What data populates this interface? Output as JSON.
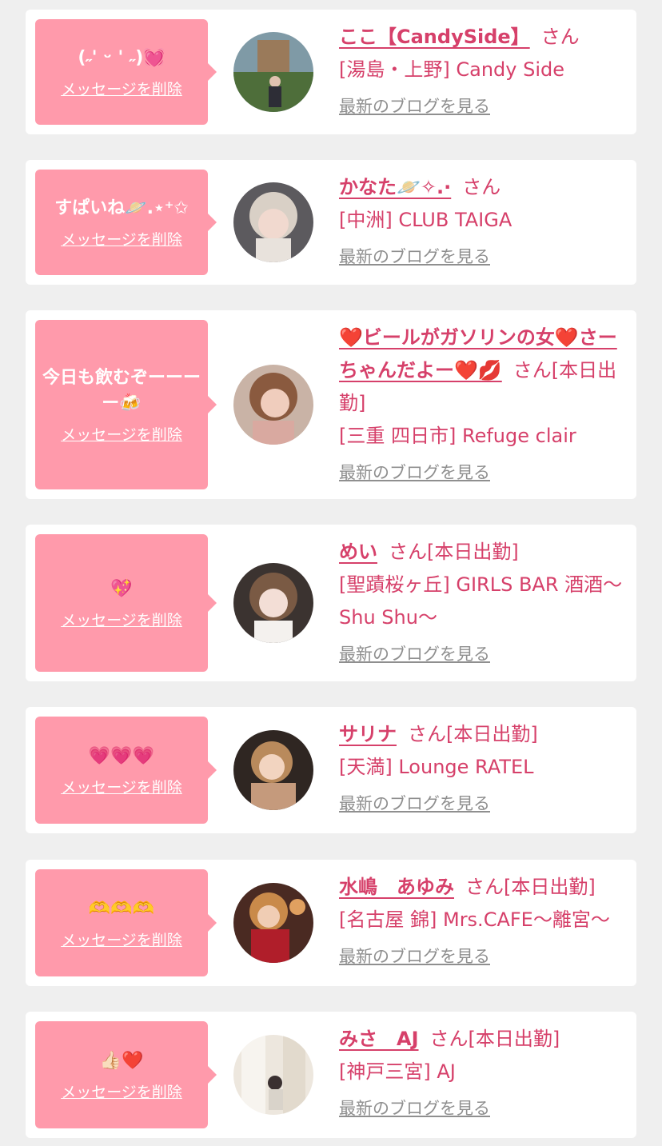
{
  "delete_label": "メッセージを削除",
  "blog_label": "最新のブログを見る",
  "suffix_san": "さん",
  "colors": {
    "bubble": "#ff9aab",
    "name": "#d6406a",
    "link_gray": "#8f8f8f",
    "background": "#efefef",
    "card": "#ffffff"
  },
  "messages": [
    {
      "message": "(˶' ᵕ ' ˶)💓",
      "name": "ここ【CandySide】",
      "status": "",
      "shop": "[湯島・上野] Candy Side"
    },
    {
      "message": "すぱいね🪐.⋆⁺✩",
      "name": "かなた🪐✧.·",
      "status": "",
      "shop": "[中洲] CLUB TAIGA"
    },
    {
      "message": "今日も飲むぞーーーー🍻",
      "name": "❤️ビールがガソリンの女❤️さーちゃんだよー❤️💋",
      "status": "[本日出勤]",
      "shop": "[三重 四日市] Refuge clair"
    },
    {
      "message": "💖",
      "name": "めい",
      "status": "[本日出勤]",
      "shop": "[聖蹟桜ヶ丘] GIRLS BAR 酒酒〜Shu Shu〜"
    },
    {
      "message": "💗💗💗",
      "name": "サリナ",
      "status": "[本日出勤]",
      "shop": "[天満] Lounge RATEL"
    },
    {
      "message": "🫶🫶🫶",
      "name": "水嶋　あゆみ",
      "status": "[本日出勤]",
      "shop": "[名古屋 錦] Mrs.CAFE〜離宮〜"
    },
    {
      "message": "👍🏻❤️",
      "name": "みさ　AJ",
      "status": "[本日出勤]",
      "shop": "[神戸三宮] AJ"
    }
  ]
}
